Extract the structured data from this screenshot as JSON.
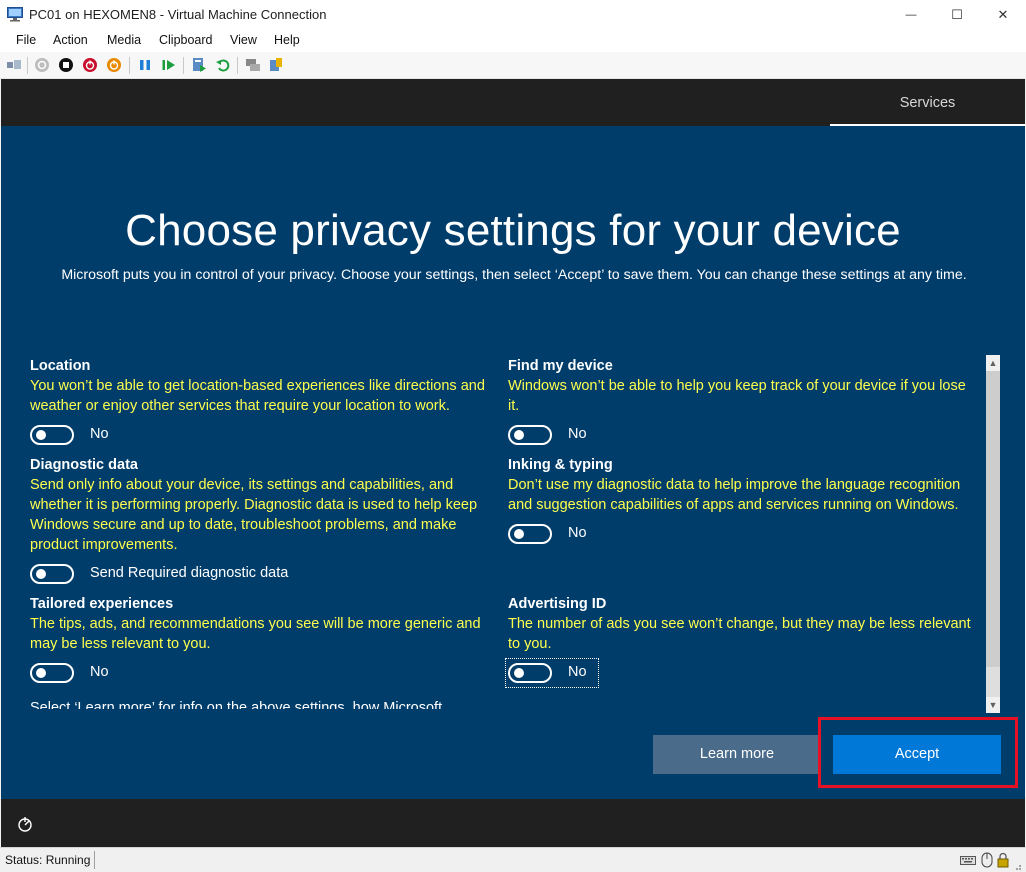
{
  "window": {
    "title": "PC01 on HEXOMEN8 - Virtual Machine Connection",
    "minimize_glyph": "—",
    "maximize_glyph": "☐",
    "close_glyph": "✕"
  },
  "menu": [
    "File",
    "Action",
    "Media",
    "Clipboard",
    "View",
    "Help"
  ],
  "toolbar_icons": [
    "ctrl-alt-del-icon",
    "start-icon",
    "turn-off-icon",
    "shutdown-icon",
    "save-icon",
    "pause-icon",
    "resume-icon",
    "checkpoint-icon",
    "revert-icon",
    "enhanced-session-icon",
    "share-icon"
  ],
  "vm": {
    "services_tab": "Services",
    "heading": "Choose privacy settings for your device",
    "subtext": "Microsoft puts you in control of your privacy. Choose your settings, then select ‘Accept’ to save them. You can change these settings at any time.",
    "settings": {
      "location": {
        "title": "Location",
        "desc": "You won’t be able to get location-based experiences like directions and weather or enjoy other services that require your location to work.",
        "state": "No"
      },
      "find_device": {
        "title": "Find my device",
        "desc": "Windows won’t be able to help you keep track of your device if you lose it.",
        "state": "No"
      },
      "diagnostic": {
        "title": "Diagnostic data",
        "desc": "Send only info about your device, its settings and capabilities, and whether it is performing properly. Diagnostic data is used to help keep Windows secure and up to date, troubleshoot problems, and make product improvements.",
        "state": "Send Required diagnostic data"
      },
      "inking": {
        "title": "Inking & typing",
        "desc": "Don’t use my diagnostic data to help improve the language recognition and suggestion capabilities of apps and services running on Windows.",
        "state": "No"
      },
      "tailored": {
        "title": "Tailored experiences",
        "desc": "The tips, ads, and recommendations you see will be more generic and may be less relevant to you.",
        "state": "No"
      },
      "advertising": {
        "title": "Advertising ID",
        "desc": "The number of ads you see won’t change, but they may be less relevant to you.",
        "state": "No"
      }
    },
    "footer_text": "Select ‘Learn more’ for info on the above settings, how Microsoft",
    "learn_more": "Learn more",
    "accept": "Accept"
  },
  "status": {
    "text": "Status: Running"
  },
  "colors": {
    "oobe_bg": "#003d6b",
    "desc_text": "#ffff4d",
    "accept_bg": "#0078d7",
    "learn_bg": "#4a6b8a",
    "highlight": "#e81123"
  }
}
